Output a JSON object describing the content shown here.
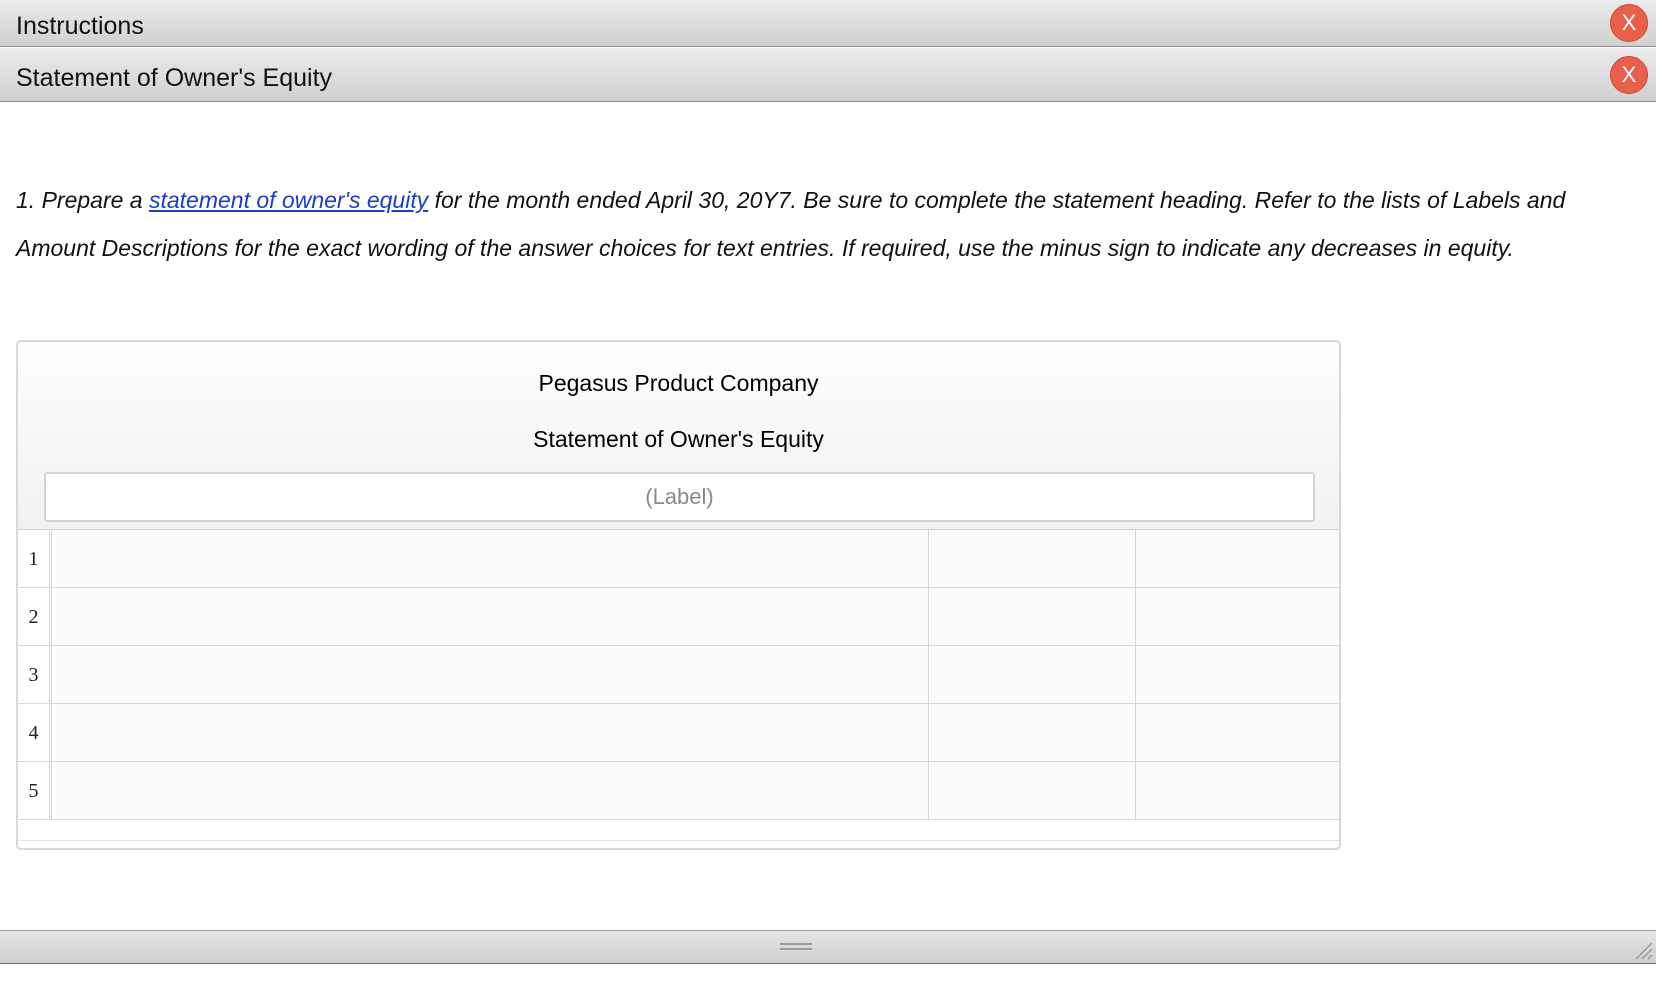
{
  "panels": {
    "instructions": {
      "title": "Instructions",
      "close_label": "X"
    },
    "statement": {
      "title": "Statement of Owner's Equity",
      "close_label": "X"
    }
  },
  "instructions": {
    "lead": "1. Prepare a ",
    "link_text": "statement of owner's equity",
    "rest": " for the month ended April 30, 20Y7. Be sure to complete the statement heading. Refer to the lists of Labels and Amount Descriptions for the exact wording of the answer choices for text entries. If required, use the minus sign to indicate any decreases in equity."
  },
  "statement": {
    "company": "Pegasus Product Company",
    "title": "Statement of Owner's Equity",
    "date_placeholder": "(Label)",
    "rows": [
      {
        "num": "1"
      },
      {
        "num": "2"
      },
      {
        "num": "3"
      },
      {
        "num": "4"
      },
      {
        "num": "5"
      }
    ]
  },
  "colors": {
    "close_button": "#e8604c",
    "link": "#1a3ccf"
  }
}
